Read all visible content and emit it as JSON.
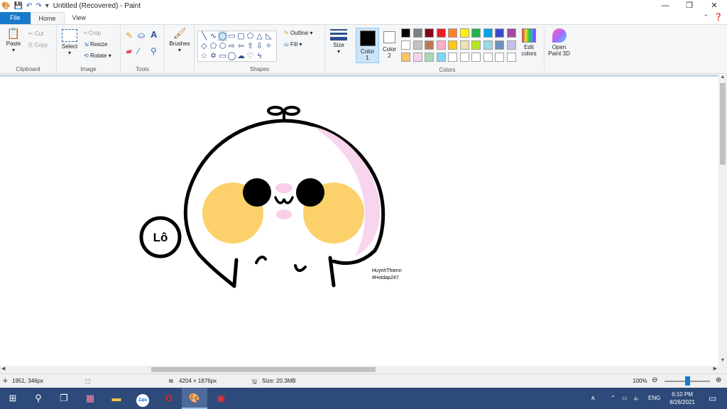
{
  "window": {
    "title": "Untitled (Recovered) - Paint",
    "minimize": "—",
    "restore": "❐",
    "close": "✕"
  },
  "tabs": [
    "File",
    "Home",
    "View"
  ],
  "ribbon": {
    "clipboard": {
      "paste": "Paste",
      "cut": "Cut",
      "copy": "Copy",
      "label": "Clipboard"
    },
    "image": {
      "select": "Select",
      "crop": "Crop",
      "resize": "Resize",
      "rotate": "Rotate",
      "label": "Image"
    },
    "tools": {
      "label": "Tools"
    },
    "brushes": "Brushes",
    "shapes": {
      "outline": "Outline",
      "fill": "Fill",
      "label": "Shapes"
    },
    "size": "Size",
    "color1": {
      "label": "Color",
      "num": "1"
    },
    "color2": {
      "label": "Color",
      "num": "2"
    },
    "colors_label": "Colors",
    "edit_colors": [
      "Edit",
      "colors"
    ],
    "open_paint3d": [
      "Open",
      "Paint 3D"
    ]
  },
  "palette": [
    [
      "#000000",
      "#7f7f7f",
      "#880015",
      "#ed1c24",
      "#ff7f27",
      "#fff200",
      "#22b14c",
      "#00a2e8",
      "#3f48cc",
      "#a349a4"
    ],
    [
      "#ffffff",
      "#c3c3c3",
      "#b97a57",
      "#ffaec9",
      "#ffc90e",
      "#efe4b0",
      "#b5e61d",
      "#99d9ea",
      "#7092be",
      "#c8bfe7"
    ],
    [
      "#f9c466",
      "#f6d3ea",
      "#a8d8b4",
      "#7fd4f7",
      "#ffffff",
      "#ffffff",
      "#ffffff",
      "#ffffff",
      "#ffffff",
      "#ffffff"
    ]
  ],
  "canvas": {
    "badge_text": "Lô",
    "signature": [
      "HuynhThienn",
      "#Hoidap247"
    ]
  },
  "status": {
    "cursor": "1951, 346px",
    "dimensions": "4204 × 1876px",
    "size": "Size: 20.3MB",
    "zoom": "100%"
  },
  "taskbar": {
    "lang": "ENG",
    "time": "6:10 PM",
    "date": "8/26/2021"
  }
}
